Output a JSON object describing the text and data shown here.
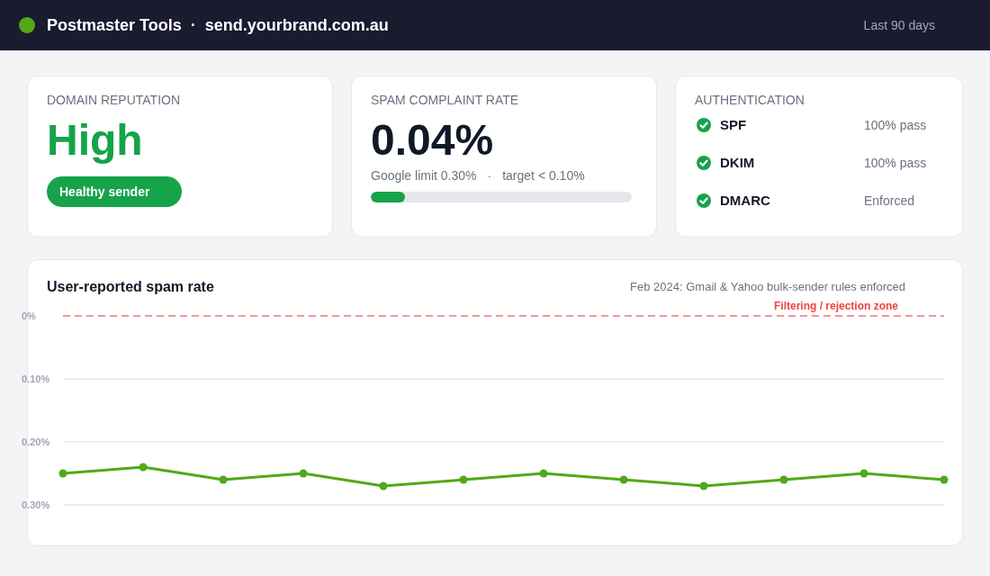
{
  "header": {
    "title": "Postmaster Tools",
    "separator": "·",
    "domain": "send.yourbrand.com.au",
    "range": "Last 90 days"
  },
  "cards": [
    {
      "kind": "reputation",
      "label": "DOMAIN REPUTATION",
      "value": "High",
      "badge": "Healthy sender"
    },
    {
      "kind": "complaint_rate",
      "label": "SPAM COMPLAINT RATE",
      "value": "0.04%",
      "limit": "Google limit 0.30%",
      "separator": "·",
      "target": "target < 0.10%",
      "level": 0.13
    },
    {
      "kind": "authentication",
      "label": "AUTHENTICATION",
      "checks": [
        {
          "name": "SPF",
          "result": "100% pass",
          "passed": true
        },
        {
          "name": "DKIM",
          "result": "100% pass",
          "passed": true
        },
        {
          "name": "DMARC",
          "result": "Enforced",
          "passed": true
        }
      ]
    }
  ],
  "chart_panel": {
    "note": "Feb 2024: Gmail & Yahoo bulk-sender rules enforced",
    "chart_data": {
      "type": "line",
      "title": "User-reported spam rate",
      "values": [
        0.25,
        0.24,
        0.26,
        0.25,
        0.27,
        0.26,
        0.25,
        0.26,
        0.27,
        0.26,
        0.25,
        0.26
      ],
      "marker": "circle",
      "ylim": [
        0.3,
        0
      ],
      "yticks": [
        {
          "value": 0,
          "label": "0%"
        },
        {
          "value": 0.1,
          "label": "0.10%"
        },
        {
          "value": 0.2,
          "label": "0.20%"
        },
        {
          "value": 0.3,
          "label": "0.30%"
        }
      ],
      "ref_lines": [
        {
          "label": "Filtering / rejection zone"
        }
      ]
    }
  }
}
